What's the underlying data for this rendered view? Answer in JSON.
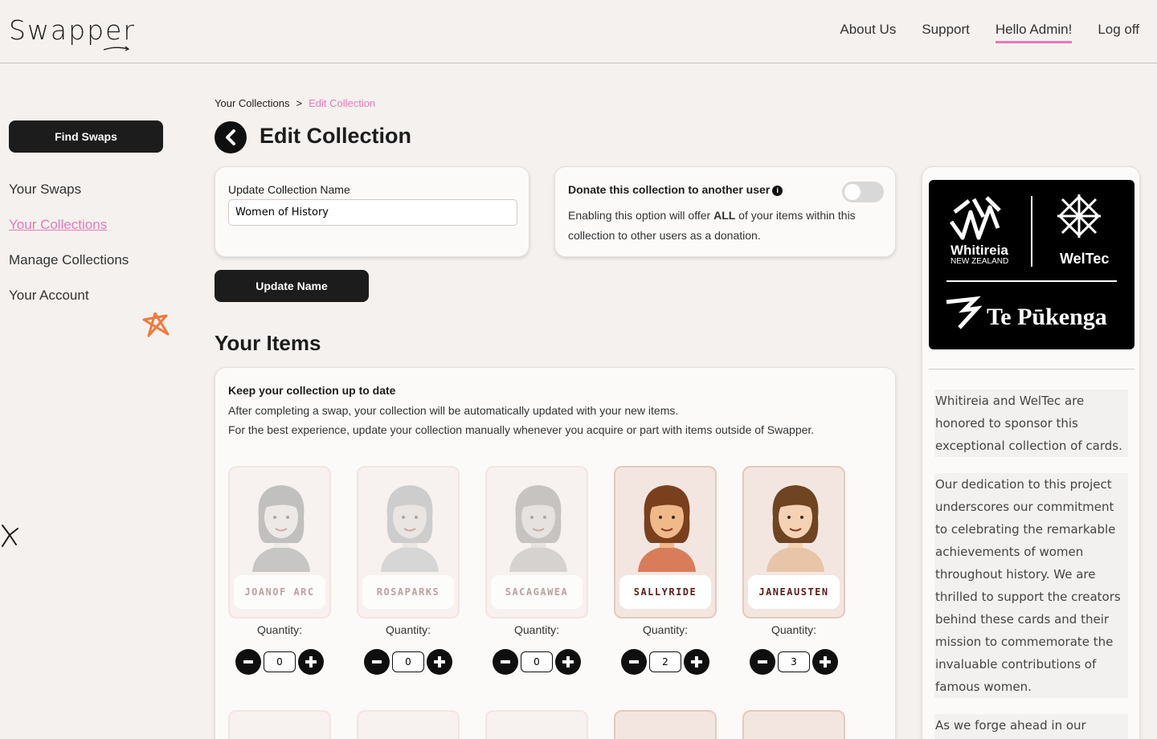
{
  "header": {
    "logo": "Swapper",
    "nav": [
      "About Us",
      "Support",
      "Hello Admin!",
      "Log off"
    ]
  },
  "sidebar": {
    "find_swaps": "Find Swaps",
    "items": [
      "Your Swaps",
      "Your Collections",
      "Manage Collections",
      "Your Account"
    ]
  },
  "breadcrumb": {
    "parent": "Your Collections",
    "separator": ">",
    "current": "Edit Collection"
  },
  "page_title": "Edit Collection",
  "name_card": {
    "label": "Update Collection Name",
    "value": "Women of History"
  },
  "update_button": "Update Name",
  "donate": {
    "title": "Donate this collection to another user",
    "desc_before": "Enabling this option will offer ",
    "desc_bold": "ALL",
    "desc_after": " of your items within this collection to other users as a donation.",
    "enabled": false
  },
  "items_section": {
    "title": "Your Items",
    "heading": "Keep your collection up to date",
    "line1": "After completing a swap, your collection will be automatically updated with your new items.",
    "line2": "For the best experience, update your collection manually whenever you acquire or part with items outside of Swapper.",
    "quantity_label": "Quantity:",
    "items": [
      {
        "name_line1": "JOAN",
        "name_line2": "OF ARC",
        "quantity": "0",
        "hair": "#6b6b6b",
        "skin": "#d9d2cd",
        "shirt": "#7a7a7a"
      },
      {
        "name_line1": "ROSA",
        "name_line2": "PARKS",
        "quantity": "0",
        "hair": "#8c8c8c",
        "skin": "#cfc6c0",
        "shirt": "#a3a3a3"
      },
      {
        "name_line1": "SACAGAWEA",
        "name_line2": "",
        "quantity": "0",
        "hair": "#7a7370",
        "skin": "#c9bfb9",
        "shirt": "#a09893"
      },
      {
        "name_line1": "SALLY",
        "name_line2": "RIDE",
        "quantity": "2",
        "hair": "#7a3f1d",
        "skin": "#f0b989",
        "shirt": "#d87c5a"
      },
      {
        "name_line1": "JANE",
        "name_line2": "AUSTEN",
        "quantity": "3",
        "hair": "#6e4423",
        "skin": "#f6d2b5",
        "shirt": "#e8c5a8"
      }
    ]
  },
  "sponsor": {
    "logo_text": [
      "Whitireia",
      "NEW ZEALAND",
      "WelTec",
      "Te Pūkenga"
    ],
    "paragraphs": [
      "Whitireia and WelTec are honored to sponsor this exceptional collection of cards.",
      "Our dedication to this project underscores our commitment to celebrating the remarkable achievements of women throughout history. We are thrilled to support the creators behind these cards and their mission to commemorate the invaluable contributions of famous women.",
      "As we forge ahead in our"
    ]
  },
  "colors": {
    "accent": "#e879b9",
    "dark": "#1c1c1c",
    "background": "#f5f1ee",
    "decor_star": "#f07a3c"
  }
}
